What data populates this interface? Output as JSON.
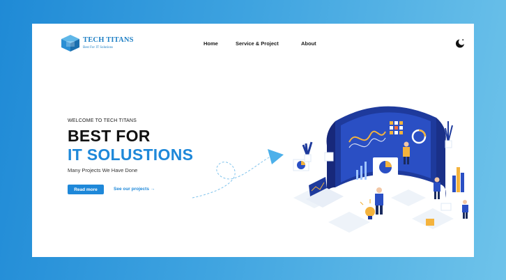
{
  "brand": {
    "title": "TECH TITANS",
    "subtitle": "Best For IT Solutions",
    "colors": {
      "primary": "#1e88d9",
      "text": "#111111",
      "background_gradient": [
        "#1f8ad6",
        "#6ec3ea"
      ]
    }
  },
  "nav": {
    "home": "Home",
    "service": "Service & Project",
    "about": "About"
  },
  "theme_toggle": {
    "icon": "moon-icon"
  },
  "hero": {
    "welcome": "WELCOME TO TECH TITANS",
    "headline_line1": "BEST FOR",
    "headline_line2": "IT SOLUSTIONS",
    "tagline": "Many Projects We Have Done",
    "primary_button": "Read more",
    "secondary_link": "See our projects →"
  }
}
